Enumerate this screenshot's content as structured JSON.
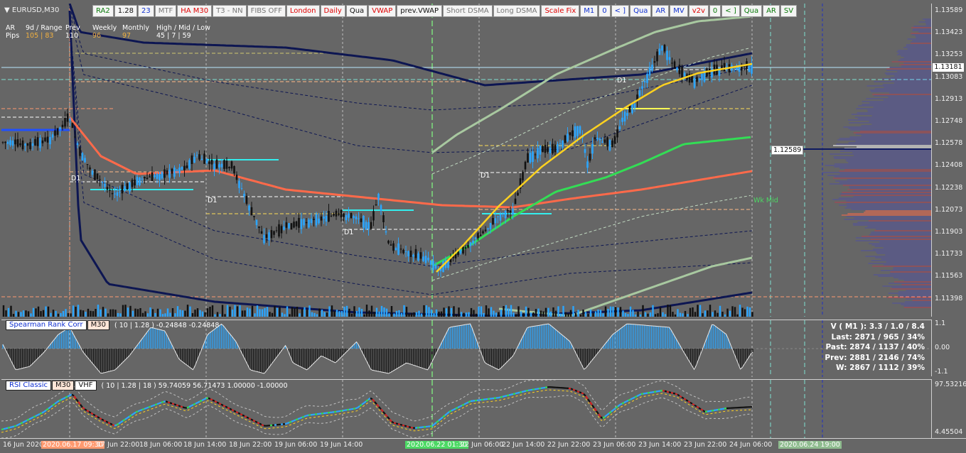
{
  "symbol": "EURUSD,M30",
  "toolbar": [
    {
      "label": "RA2",
      "style": "green"
    },
    {
      "label": "1.28",
      "style": "dark"
    },
    {
      "label": "23",
      "style": "blue"
    },
    {
      "label": "MTF",
      "style": "gray"
    },
    {
      "label": "HA M30",
      "style": "red"
    },
    {
      "label": "T3 - NN",
      "style": "gray"
    },
    {
      "label": "FIBS OFF",
      "style": "gray"
    },
    {
      "label": "London",
      "style": "red"
    },
    {
      "label": "Daily",
      "style": "red"
    },
    {
      "label": "Qua",
      "style": "dark"
    },
    {
      "label": "VWAP",
      "style": "red"
    },
    {
      "label": "prev.VWAP",
      "style": "dark"
    },
    {
      "label": "Short DSMA",
      "style": "gray"
    },
    {
      "label": "Long DSMA",
      "style": "gray"
    },
    {
      "label": "Scale Fix",
      "style": "red"
    },
    {
      "label": "M1",
      "style": "blue"
    },
    {
      "label": "0",
      "style": "blue"
    },
    {
      "label": "< ]",
      "style": "blue"
    },
    {
      "label": "Qua",
      "style": "blue"
    },
    {
      "label": "AR",
      "style": "blue"
    },
    {
      "label": "MV",
      "style": "blue"
    },
    {
      "label": "v2v",
      "style": "red"
    },
    {
      "label": "0",
      "style": "green"
    },
    {
      "label": "< ]",
      "style": "green"
    },
    {
      "label": "Qua",
      "style": "green"
    },
    {
      "label": "AR",
      "style": "green"
    },
    {
      "label": "SV",
      "style": "green"
    }
  ],
  "info": {
    "row1": [
      "AR",
      "9d / Range",
      "Prev",
      "Weekly",
      "Monthly",
      "High / Mid / Low"
    ],
    "row2_label": "Pips",
    "ar_values": "105 | 83",
    "prev_value": "110",
    "weekly_value": "96",
    "monthly_value": "97",
    "hml_values": "45  |  7  |  59"
  },
  "price_axis": [
    "1.13589",
    "1.13423",
    "1.13253",
    "1.13083",
    "1.12913",
    "1.12748",
    "1.12578",
    "1.12408",
    "1.12238",
    "1.12073",
    "1.11903",
    "1.11733",
    "1.11563",
    "1.11398"
  ],
  "current_price": "1.13181",
  "level_tag": "1.12589",
  "chart_labels": {
    "d1_tags": [
      "D1",
      "D1",
      "D1",
      "D1",
      "D1"
    ],
    "wk_mid": "Wk Mid"
  },
  "spearman": {
    "name": "Spearman Rank Corr",
    "tf": "M30",
    "params": "( 10 | 1.28 ) -0.24848 -0.24848",
    "axis": [
      "1.1",
      "0.00",
      "-1.1"
    ]
  },
  "rsi": {
    "name": "RSI Classic",
    "tf": "M30",
    "extra": "VHF",
    "params": "( 10 | 1.28 | 18 ) 59.74059 56.71473 1.00000 -1.00000",
    "axis": [
      "97.53216",
      "4.45504"
    ]
  },
  "stats": [
    "V ( M1 ): 3.3 / 1.0 / 8.4",
    "Last: 2871 / 965 / 34%",
    "Past: 2874 / 1137 / 40%",
    "Prev: 2881 / 2146 / 74%",
    "W: 2867 / 1112 / 39%"
  ],
  "time_axis": [
    {
      "label": "16 Jun 2020",
      "style": ""
    },
    {
      "label": "2020.06.17 09:30",
      "style": "hl1"
    },
    {
      "label": "17 Jun 22:00",
      "style": ""
    },
    {
      "label": "18 Jun 06:00",
      "style": ""
    },
    {
      "label": "18 Jun 14:00",
      "style": ""
    },
    {
      "label": "18 Jun 22:00",
      "style": ""
    },
    {
      "label": "19 Jun 06:00",
      "style": ""
    },
    {
      "label": "19 Jun 14:00",
      "style": ""
    },
    {
      "label": "2020.06.22 01:30",
      "style": "hl2"
    },
    {
      "label": "22 Jun 06:00",
      "style": ""
    },
    {
      "label": "22 Jun 14:00",
      "style": ""
    },
    {
      "label": "22 Jun 22:00",
      "style": ""
    },
    {
      "label": "23 Jun 06:00",
      "style": ""
    },
    {
      "label": "23 Jun 14:00",
      "style": ""
    },
    {
      "label": "23 Jun 22:00",
      "style": ""
    },
    {
      "label": "24 Jun 06:00",
      "style": ""
    },
    {
      "label": "2020.06.24 19:00",
      "style": "hl3"
    }
  ],
  "colors": {
    "background": "#666666",
    "candle_up": "#2ba6ff",
    "candle_down": "#111111",
    "vwap": "#ffd21f",
    "ema": "#ff6a4a",
    "band_dark": "#0d1652",
    "band_green": "#33dd55",
    "band_sage": "#a8c8a0"
  }
}
